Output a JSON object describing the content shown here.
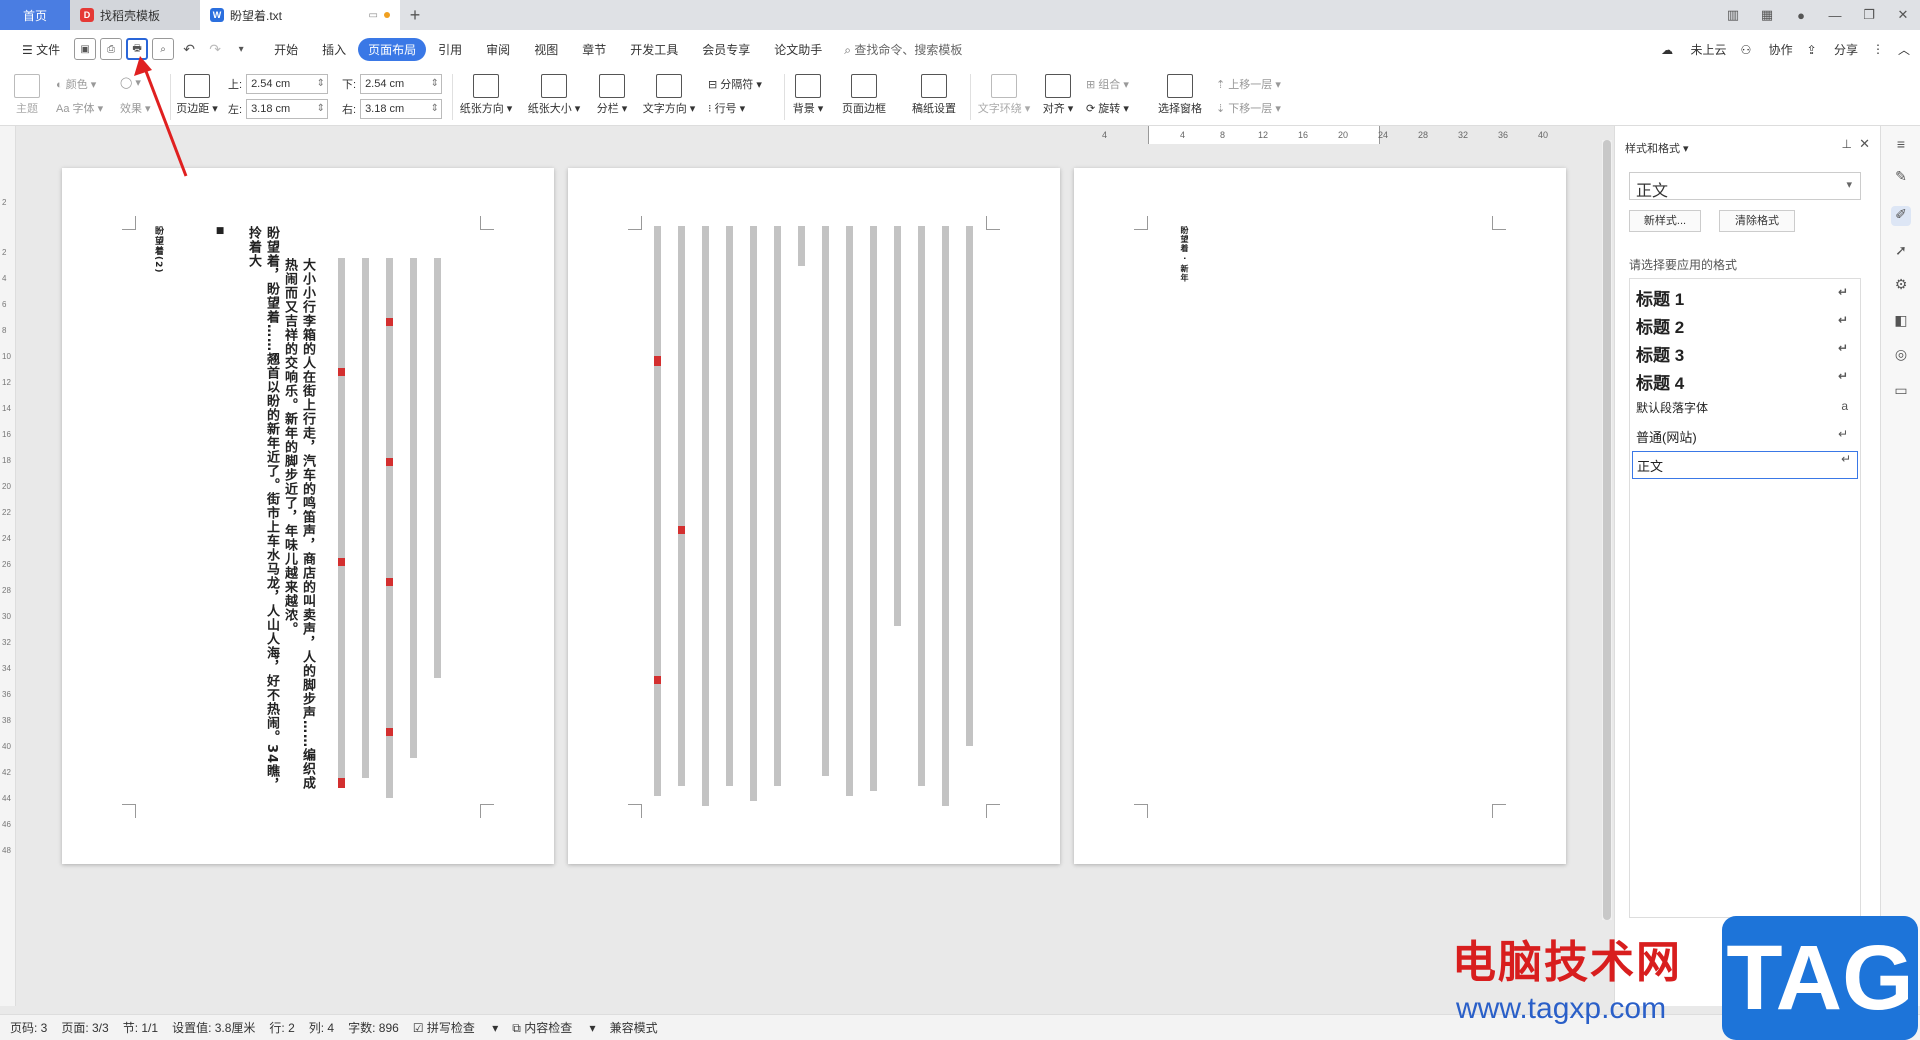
{
  "tabs": {
    "home": "首页",
    "template": "找稻壳模板",
    "doc": "盼望着.txt"
  },
  "menu": {
    "file": "文件",
    "items": [
      "开始",
      "插入",
      "页面布局",
      "引用",
      "审阅",
      "视图",
      "章节",
      "开发工具",
      "会员专享",
      "论文助手"
    ],
    "active": "页面布局",
    "search": "查找命令、搜索模板",
    "cloud": "未上云",
    "collab": "协作",
    "share": "分享"
  },
  "ribbon": {
    "theme": "主题",
    "color": "颜色",
    "font": "字体",
    "effect": "效果",
    "margins": "页边距",
    "top_label": "上:",
    "top_value": "2.54 cm",
    "bottom_label": "下:",
    "bottom_value": "2.54 cm",
    "left_label": "左:",
    "left_value": "3.18 cm",
    "right_label": "右:",
    "right_value": "3.18 cm",
    "orientation": "纸张方向",
    "size": "纸张大小",
    "columns": "分栏",
    "text_direction": "文字方向",
    "separator": "分隔符",
    "line_number": "行号",
    "background": "背景",
    "page_border": "页面边框",
    "manuscript": "稿纸设置",
    "text_wrap": "文字环绕",
    "align": "对齐",
    "group": "组合",
    "rotate": "旋转",
    "selection_pane": "选择窗格",
    "bring_forward": "上移一层",
    "send_backward": "下移一层"
  },
  "ruler": {
    "top_ticks": [
      "4",
      "4",
      "8",
      "12",
      "16",
      "20",
      "24",
      "28",
      "32",
      "36",
      "40"
    ],
    "left_ticks": [
      "2",
      "2",
      "4",
      "6",
      "8",
      "10",
      "12",
      "14",
      "16",
      "18",
      "20",
      "22",
      "24",
      "26",
      "28",
      "30",
      "32",
      "34",
      "36",
      "38",
      "40",
      "42",
      "44",
      "46",
      "48"
    ]
  },
  "pages": {
    "p1_heading": "盼望着(2)",
    "p1_cols": [
      "大小小行李箱的人在街上行走，汽车的鸣笛声，商店的叫卖声，人的脚步声……编织成热闹而又吉祥的交响乐。新年的脚步近了，年味儿越来越浓。",
      "盼望着，盼望着……翘首以盼的新年近了。街市上车水马龙，人山人海，好不热闹。34瞧，拎着大"
    ],
    "p3_heading": "盼望着 · 新年"
  },
  "panel": {
    "title": "样式和格式",
    "current": "正文",
    "new_style": "新样式...",
    "clear": "清除格式",
    "prompt": "请选择要应用的格式",
    "styles": [
      "标题 1",
      "标题 2",
      "标题 3",
      "标题 4",
      "默认段落字体",
      "普通(网站)",
      "正文"
    ]
  },
  "status": {
    "page_num": "页码: 3",
    "pages": "页面: 3/3",
    "section": "节: 1/1",
    "setting": "设置值: 3.8厘米",
    "row": "行: 2",
    "col": "列: 4",
    "words": "字数: 896",
    "spell": "拼写检查",
    "content_check": "内容检查",
    "compat": "兼容模式"
  },
  "watermark": {
    "site_cn": "电脑技术网",
    "url": "www.tagxp.com",
    "tag": "TAG"
  }
}
